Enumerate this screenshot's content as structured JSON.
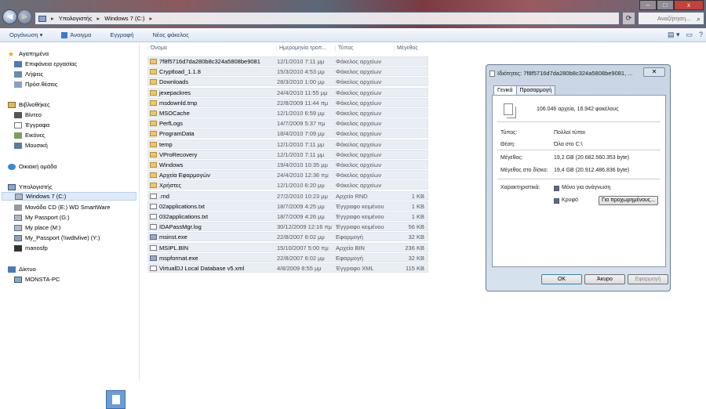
{
  "titlebar": {
    "window_controls": {
      "minimize": "–",
      "maximize": "□",
      "close": "x"
    },
    "address": [
      "Υπολογιστής",
      "Windows 7 (C:)"
    ],
    "search_placeholder": "Αναζήτηση..."
  },
  "toolbar": {
    "organize": "Οργάνωση ▾",
    "open": "Άνοιγμα",
    "burn": "Εγγραφή",
    "new_folder": "Νέος φάκελος"
  },
  "nav": {
    "favorites": "Αγαπημένα",
    "fav_items": [
      "Επιφάνεια εργασίας",
      "Λήψεις",
      "Πρόσ.θέσεις"
    ],
    "libraries": "Βιβλιοθήκες",
    "lib_items": [
      "Βίντεο",
      "Έγγραφα",
      "Εικόνες",
      "Μουσική"
    ],
    "homegroup": "Οικιακή ομάδα",
    "computer": "Υπολογιστής",
    "comp_items": [
      "Windows 7 (C:)",
      "Μονάδα CD (E:) WD SmartWare",
      "My Passport (G:)",
      "My place (M:)",
      "My_Passport (\\\\wdtvlive) (Y:)",
      "manosfp"
    ],
    "network": "Δίκτυο",
    "net_items": [
      "MONSTA-PC"
    ]
  },
  "columns": {
    "name": "Όνομα",
    "date": "Ημερομηνία τροπ...",
    "type": "Τύπος",
    "size": "Μέγεθος"
  },
  "files": [
    {
      "n": "7f8f5716d7da280b8c324a5808be9081",
      "d": "12/1/2010 7:11 μμ",
      "t": "Φάκελος αρχείων",
      "s": "",
      "k": "folder"
    },
    {
      "n": "Cryptload_1.1.8",
      "d": "15/3/2010 4:53 μμ",
      "t": "Φάκελος αρχείων",
      "s": "",
      "k": "folder"
    },
    {
      "n": "Downloads",
      "d": "28/3/2010 1:00 μμ",
      "t": "Φάκελος αρχείων",
      "s": "",
      "k": "folder"
    },
    {
      "n": "jexepackres",
      "d": "24/4/2010 11:55 μμ",
      "t": "Φάκελος αρχείων",
      "s": "",
      "k": "folder"
    },
    {
      "n": "msdownld.tmp",
      "d": "22/8/2009 11:44 πμ",
      "t": "Φάκελος αρχείων",
      "s": "",
      "k": "folder"
    },
    {
      "n": "MSOCache",
      "d": "12/1/2010 6:59 μμ",
      "t": "Φάκελος αρχείων",
      "s": "",
      "k": "folder"
    },
    {
      "n": "PerfLogs",
      "d": "14/7/2009 5:37 πμ",
      "t": "Φάκελος αρχείων",
      "s": "",
      "k": "folder"
    },
    {
      "n": "ProgramData",
      "d": "18/4/2010 7:09 μμ",
      "t": "Φάκελος αρχείων",
      "s": "",
      "k": "folder"
    },
    {
      "n": "temp",
      "d": "12/1/2010 7:11 μμ",
      "t": "Φάκελος αρχείων",
      "s": "",
      "k": "folder"
    },
    {
      "n": "VProRecovery",
      "d": "12/1/2010 7:11 μμ",
      "t": "Φάκελος αρχείων",
      "s": "",
      "k": "folder"
    },
    {
      "n": "Windows",
      "d": "19/4/2010 10:35 μμ",
      "t": "Φάκελος αρχείων",
      "s": "",
      "k": "folder"
    },
    {
      "n": "Αρχεία Εφαρμογών",
      "d": "24/4/2010 12:36 πμ",
      "t": "Φάκελος αρχείων",
      "s": "",
      "k": "folder"
    },
    {
      "n": "Χρήστες",
      "d": "12/1/2010 6:20 μμ",
      "t": "Φάκελος αρχείων",
      "s": "",
      "k": "folder"
    },
    {
      "n": ".rnd",
      "d": "27/2/2010 10:23 μμ",
      "t": "Αρχείο RND",
      "s": "1 KB",
      "k": "file"
    },
    {
      "n": "02applications.txt",
      "d": "18/7/2009 4:25 μμ",
      "t": "Έγγραφο κειμένου",
      "s": "1 KB",
      "k": "file"
    },
    {
      "n": "032applications.txt",
      "d": "18/7/2009 4:26 μμ",
      "t": "Έγγραφο κειμένου",
      "s": "1 KB",
      "k": "file"
    },
    {
      "n": "IDAPassMgr.log",
      "d": "30/12/2009 12:16 πμ",
      "t": "Έγγραφο κειμένου",
      "s": "56 KB",
      "k": "file"
    },
    {
      "n": "msinst.exe",
      "d": "22/8/2007 6:02 μμ",
      "t": "Εφαρμογή",
      "s": "32 KB",
      "k": "exe"
    },
    {
      "n": "MSIPL.BIN",
      "d": "15/10/2007 5:00 πμ",
      "t": "Αρχείο BIN",
      "s": "236 KB",
      "k": "file"
    },
    {
      "n": "mspformat.exe",
      "d": "22/8/2007 6:02 μμ",
      "t": "Εφαρμογή",
      "s": "32 KB",
      "k": "exe"
    },
    {
      "n": "VirtualDJ Local Database v5.xml",
      "d": "4/8/2009 8:55 μμ",
      "t": "Έγγραφο XML",
      "s": "115 KB",
      "k": "file"
    }
  ],
  "dialog": {
    "title": "Ιδιότητες: 7f8f5716d7da280b8c324a5808be9081, ...",
    "tabs": [
      "Γενικά",
      "Προσαρμογή"
    ],
    "summary": "106.046 αρχεία, 16.942 φακέλους",
    "type_label": "Τύπος:",
    "type_value": "Πολλοί τύποι",
    "loc_label": "Θέση:",
    "loc_value": "Όλα στο C:\\",
    "size_label": "Μέγεθος:",
    "size_value": "19,2 GB (20.682.560.353 byte)",
    "disk_label": "Μέγεθος στο δίσκο:",
    "disk_value": "19,4 GB (20.912.486.836 byte)",
    "attr_label": "Χαρακτηριστικά:",
    "readonly": "Μόνο για ανάγνωση",
    "hidden": "Κρυφό",
    "advanced": "Για προχωρημένους...",
    "ok": "OK",
    "cancel": "Άκυρο",
    "apply": "Εφαρμογή"
  }
}
